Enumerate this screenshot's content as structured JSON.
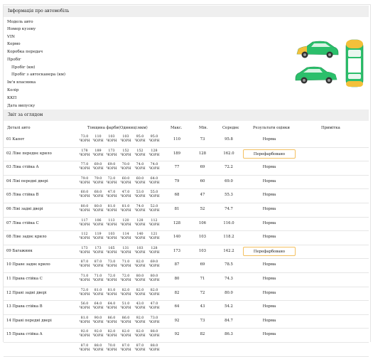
{
  "car_info": {
    "title": "Інформація про автомобіль",
    "fields": [
      "Модель авто",
      "Номер кузову",
      "VIN",
      "Кермо",
      "Коробка передач",
      "Пробіг"
    ],
    "mileage_sub": [
      "Пробіг (км)",
      "Пробіг з автосканера (км)"
    ],
    "fields2": [
      "Ім'я власника",
      "Колір",
      "ККП",
      "Дата випуску"
    ]
  },
  "report": {
    "title": "Звіт за оглядом",
    "headers": {
      "part": "Деталі авто",
      "thickness": "Товщина фарби(Одиниці:мкм)",
      "max": "Макс.",
      "min": "Мін.",
      "avg": "Середнє",
      "result": "Результати оцінки",
      "note": "Примітка"
    },
    "unit": "ЧОРН",
    "rows": [
      {
        "part": "01 Капот",
        "t": [
          "73.0",
          "110",
          "103",
          "103",
          "95.0",
          "95.0"
        ],
        "max": "110",
        "min": "73",
        "avg": "95.8",
        "result": "Норма",
        "repaint": false
      },
      {
        "part": "02 Ліве переднє крило",
        "t": [
          "178",
          "189",
          "173",
          "152",
          "152",
          "128"
        ],
        "max": "189",
        "min": "128",
        "avg": "162.0",
        "result": "Перефарбовано",
        "repaint": true
      },
      {
        "part": "03 Ліва стійка A",
        "t": [
          "77.0",
          "69.0",
          "69.0",
          "70.0",
          "74.0",
          "74.0"
        ],
        "max": "77",
        "min": "69",
        "avg": "72.2",
        "result": "Норма",
        "repaint": false
      },
      {
        "part": "04 Ліві передні двері",
        "t": [
          "79.0",
          "79.0",
          "72.0",
          "60.0",
          "60.0",
          "64.0"
        ],
        "max": "79",
        "min": "60",
        "avg": "69.0",
        "result": "Норма",
        "repaint": false
      },
      {
        "part": "05 Ліва стійка B",
        "t": [
          "60.0",
          "68.0",
          "47.0",
          "47.0",
          "53.0",
          "55.0"
        ],
        "max": "68",
        "min": "47",
        "avg": "55.3",
        "result": "Норма",
        "repaint": false
      },
      {
        "part": "06 Ліві задні двері",
        "t": [
          "80.0",
          "80.0",
          "81.0",
          "81.0",
          "74.0",
          "52.0"
        ],
        "max": "81",
        "min": "52",
        "avg": "74.7",
        "result": "Норма",
        "repaint": false
      },
      {
        "part": "07 Ліва стійка C",
        "t": [
          "117",
          "106",
          "113",
          "120",
          "128",
          "112"
        ],
        "max": "128",
        "min": "106",
        "avg": "116.0",
        "result": "Норма",
        "repaint": false
      },
      {
        "part": "08 Ліве заднє крило",
        "t": [
          "112",
          "119",
          "103",
          "114",
          "140",
          "121"
        ],
        "max": "140",
        "min": "103",
        "avg": "118.2",
        "result": "Норма",
        "repaint": false
      },
      {
        "part": "09 Багажник",
        "t": [
          "173",
          "173",
          "165",
          "131",
          "103",
          "128"
        ],
        "max": "173",
        "min": "103",
        "avg": "142.2",
        "result": "Перефарбовано",
        "repaint": true
      },
      {
        "part": "10 Праве заднє крило",
        "t": [
          "87.0",
          "87.0",
          "73.0",
          "71.0",
          "82.0",
          "69.0"
        ],
        "max": "87",
        "min": "69",
        "avg": "78.5",
        "result": "Норма",
        "repaint": false
      },
      {
        "part": "11 Права стійка C",
        "t": [
          "71.0",
          "71.0",
          "72.0",
          "72.0",
          "80.0",
          "80.0"
        ],
        "max": "80",
        "min": "71",
        "avg": "74.3",
        "result": "Норма",
        "repaint": false
      },
      {
        "part": "12 Праві задні двері",
        "t": [
          "72.0",
          "81.0",
          "81.0",
          "82.0",
          "82.0",
          "82.0"
        ],
        "max": "82",
        "min": "72",
        "avg": "80.0",
        "result": "Норма",
        "repaint": false
      },
      {
        "part": "13 Права стійка B",
        "t": [
          "56.0",
          "64.0",
          "64.0",
          "51.0",
          "43.0",
          "47.0"
        ],
        "max": "64",
        "min": "43",
        "avg": "54.2",
        "result": "Норма",
        "repaint": false
      },
      {
        "part": "14 Праві передні двері",
        "t": [
          "81.0",
          "90.0",
          "86.0",
          "86.0",
          "92.0",
          "73.0"
        ],
        "max": "92",
        "min": "73",
        "avg": "84.7",
        "result": "Норма",
        "repaint": false
      },
      {
        "part": "15 Права стійка A",
        "t": [
          "92.0",
          "92.0",
          "82.0",
          "82.0",
          "82.0",
          "88.0"
        ],
        "max": "92",
        "min": "82",
        "avg": "86.3",
        "result": "Норма",
        "repaint": false
      },
      {
        "part": "",
        "t": [
          "87.0",
          "88.0",
          "70.0",
          "87.0",
          "87.0",
          "88.0"
        ],
        "max": "",
        "min": "",
        "avg": "",
        "result": "",
        "repaint": false
      }
    ]
  },
  "colors": {
    "car_green": "#2bbf6b",
    "car_yellow": "#f3c03a",
    "highlight_border": "#f3c060"
  }
}
